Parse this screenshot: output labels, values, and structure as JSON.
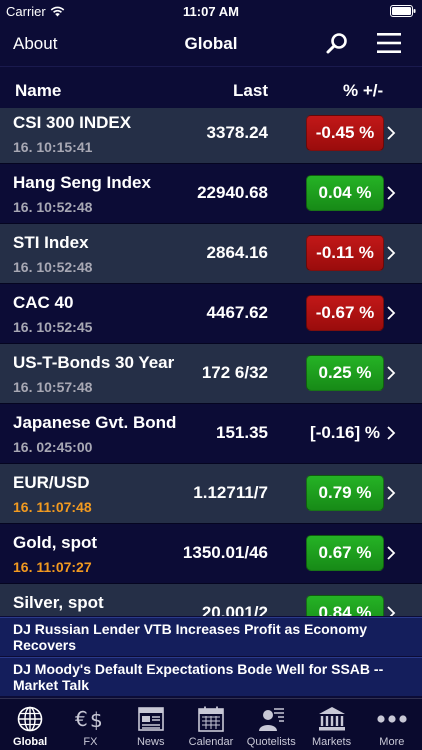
{
  "status": {
    "carrier": "Carrier",
    "time": "11:07 AM"
  },
  "nav": {
    "about": "About",
    "title": "Global"
  },
  "columns": {
    "name": "Name",
    "last": "Last",
    "pct": "% +/-"
  },
  "rows": [
    {
      "name": "CSI 300 INDEX",
      "time": "16. 10:15:41",
      "last": "3378.24",
      "pct": "-0.45 %",
      "trend": "down",
      "fresh": false
    },
    {
      "name": "Hang Seng Index",
      "time": "16. 10:52:48",
      "last": "22940.68",
      "pct": "0.04 %",
      "trend": "up",
      "fresh": false
    },
    {
      "name": "STI Index",
      "time": "16. 10:52:48",
      "last": "2864.16",
      "pct": "-0.11 %",
      "trend": "down",
      "fresh": false
    },
    {
      "name": "CAC 40",
      "time": "16. 10:52:45",
      "last": "4467.62",
      "pct": "-0.67 %",
      "trend": "down",
      "fresh": false
    },
    {
      "name": "US-T-Bonds 30 Year",
      "time": "16. 10:57:48",
      "last": "172 6/32",
      "pct": "0.25 %",
      "trend": "up",
      "fresh": false
    },
    {
      "name": "Japanese Gvt. Bond",
      "time": "16. 02:45:00",
      "last": "151.35",
      "pct": "[-0.16] %",
      "trend": "flat",
      "fresh": false
    },
    {
      "name": "EUR/USD",
      "time": "16. 11:07:48",
      "last": "1.12711/7",
      "pct": "0.79 %",
      "trend": "up",
      "fresh": true
    },
    {
      "name": "Gold, spot",
      "time": "16. 11:07:27",
      "last": "1350.01/46",
      "pct": "0.67 %",
      "trend": "up",
      "fresh": true
    },
    {
      "name": "Silver, spot",
      "time": "",
      "last": "20.001/2",
      "pct": "0.84 %",
      "trend": "up",
      "fresh": false
    }
  ],
  "news": [
    "DJ Russian Lender VTB Increases Profit as Economy Recovers",
    "DJ Moody's Default Expectations Bode Well for SSAB -- Market Talk"
  ],
  "tabs": [
    {
      "label": "Global",
      "icon": "globe-icon",
      "active": true
    },
    {
      "label": "FX",
      "icon": "currency-icon",
      "active": false
    },
    {
      "label": "News",
      "icon": "newspaper-icon",
      "active": false
    },
    {
      "label": "Calendar",
      "icon": "calendar-icon",
      "active": false
    },
    {
      "label": "Quotelists",
      "icon": "quotelist-icon",
      "active": false
    },
    {
      "label": "Markets",
      "icon": "bank-icon",
      "active": false
    },
    {
      "label": "More",
      "icon": "more-icon",
      "active": false
    }
  ],
  "colors": {
    "background": "#0c0c36",
    "row_alt": "#252f47",
    "down": "#b01212",
    "up": "#1ea31e",
    "fresh_time": "#f29a20",
    "news_bg": "#141e5c"
  }
}
